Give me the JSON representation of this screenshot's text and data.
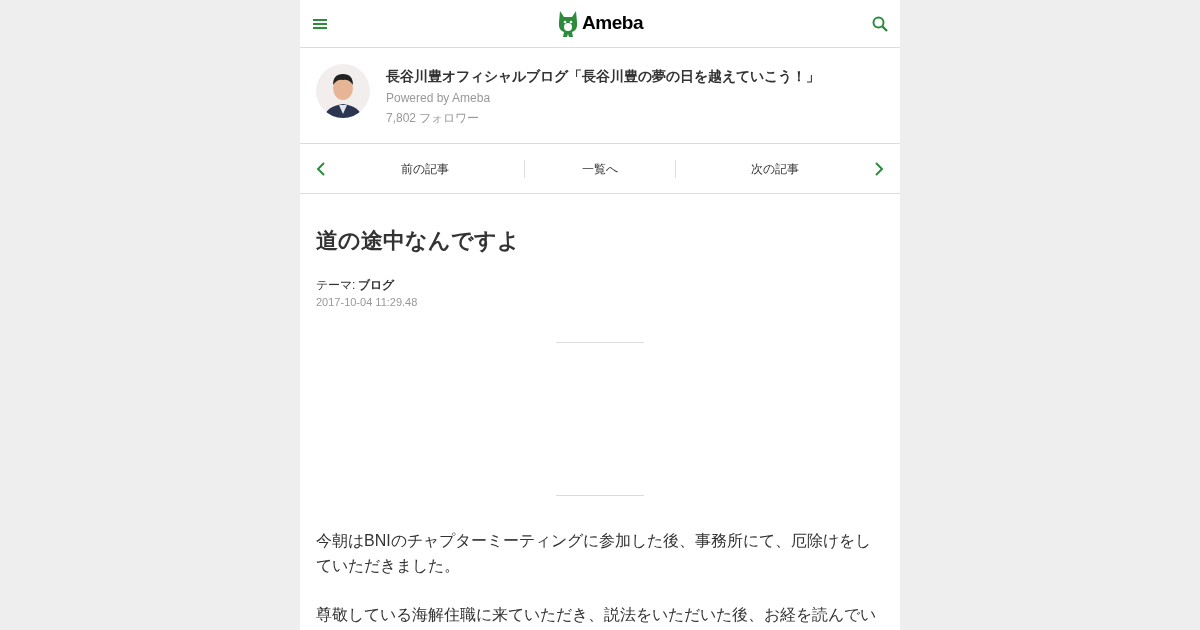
{
  "header": {
    "logo": "Ameba"
  },
  "blog": {
    "title": "長谷川豊オフィシャルブログ「長谷川豊の夢の日を越えていこう！」",
    "powered_by": "Powered by Ameba",
    "followers": "7,802 フォロワー"
  },
  "nav": {
    "prev": "前の記事",
    "list": "一覧へ",
    "next": "次の記事"
  },
  "article": {
    "title": "道の途中なんですよ",
    "theme_label": "テーマ:",
    "theme": "ブログ",
    "date": "2017-10-04 11:29.48",
    "paragraphs": [
      "今朝はBNIのチャプターミーティングに参加した後、事務所にて、厄除けをしていただきました。",
      "尊敬している海解住職に来ていただき、説法をいただいた後、お経を読んでい"
    ]
  }
}
